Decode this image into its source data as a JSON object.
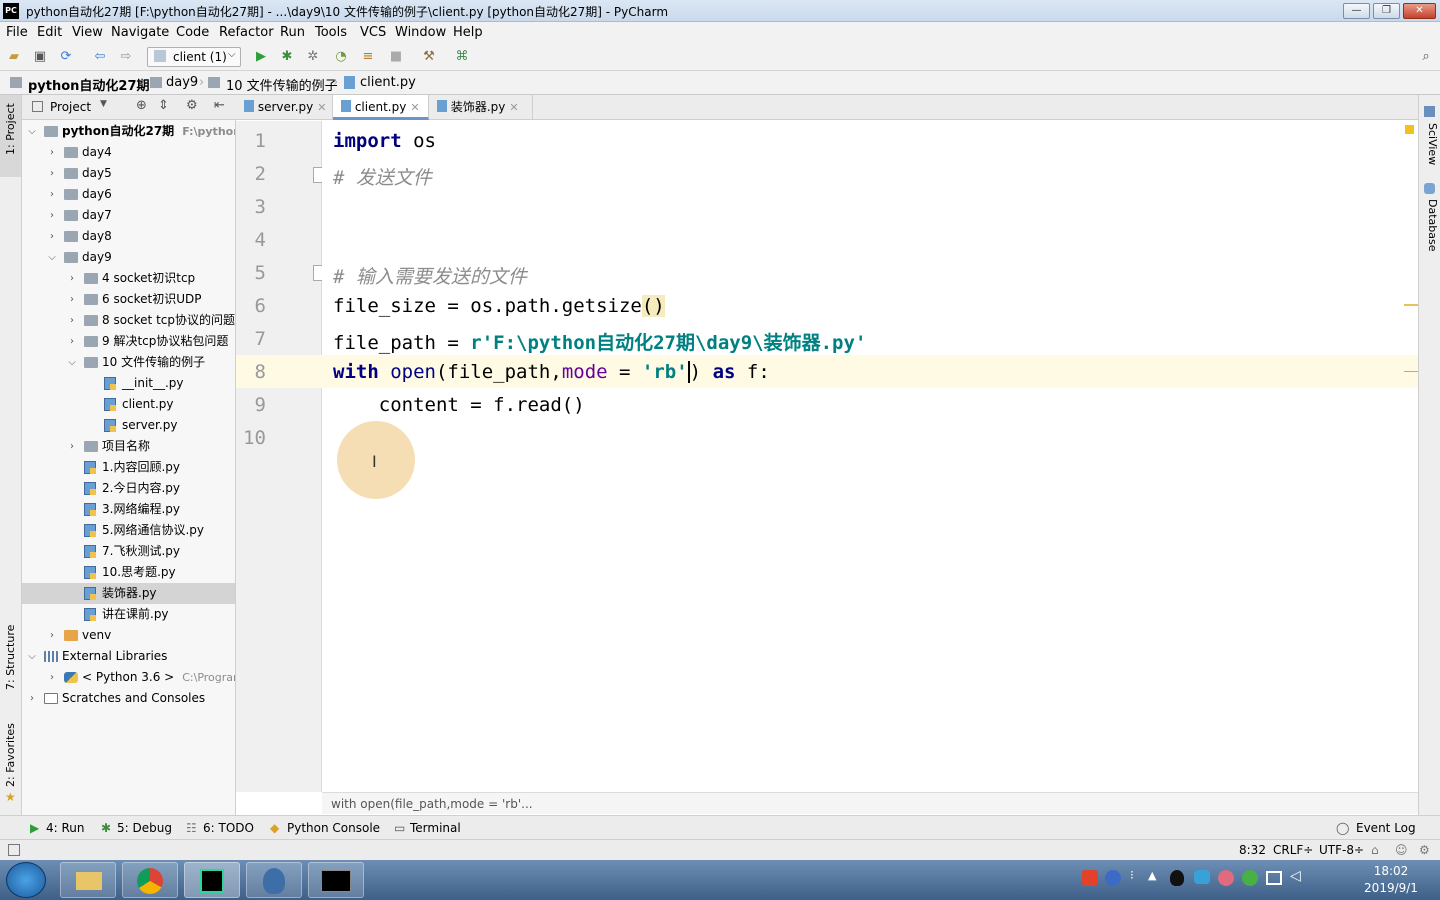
{
  "window": {
    "title": "python自动化27期 [F:\\python自动化27期] - ...\\day9\\10 文件传输的例子\\client.py [python自动化27期] - PyCharm",
    "app_icon": "PC",
    "min_label": "—",
    "max_label": "❐",
    "close_label": "✕"
  },
  "menu": [
    "File",
    "Edit",
    "View",
    "Navigate",
    "Code",
    "Refactor",
    "Run",
    "Tools",
    "VCS",
    "Window",
    "Help"
  ],
  "toolbar": {
    "run_config": "client (1)"
  },
  "breadcrumb": [
    "python自动化27期",
    "day9",
    "10 文件传输的例子",
    "client.py"
  ],
  "project_panel": {
    "title": "Project",
    "tree": [
      {
        "label": "python自动化27期",
        "hint": "F:\\python自",
        "kind": "folder",
        "depth": 0,
        "expanded": true,
        "bold": true
      },
      {
        "label": "day4",
        "kind": "folder",
        "depth": 1,
        "expanded": false
      },
      {
        "label": "day5",
        "kind": "folder",
        "depth": 1,
        "expanded": false
      },
      {
        "label": "day6",
        "kind": "folder",
        "depth": 1,
        "expanded": false
      },
      {
        "label": "day7",
        "kind": "folder",
        "depth": 1,
        "expanded": false
      },
      {
        "label": "day8",
        "kind": "folder",
        "depth": 1,
        "expanded": false
      },
      {
        "label": "day9",
        "kind": "folder",
        "depth": 1,
        "expanded": true
      },
      {
        "label": "4 socket初识tcp",
        "kind": "folder",
        "depth": 2,
        "expanded": false
      },
      {
        "label": "6 socket初识UDP",
        "kind": "folder",
        "depth": 2,
        "expanded": false
      },
      {
        "label": "8 socket tcp协议的问题",
        "kind": "folder",
        "depth": 2,
        "expanded": false
      },
      {
        "label": "9 解决tcp协议粘包问题",
        "kind": "folder",
        "depth": 2,
        "expanded": false
      },
      {
        "label": "10 文件传输的例子",
        "kind": "folder",
        "depth": 2,
        "expanded": true
      },
      {
        "label": "__init__.py",
        "kind": "py",
        "depth": 3
      },
      {
        "label": "client.py",
        "kind": "py",
        "depth": 3
      },
      {
        "label": "server.py",
        "kind": "py",
        "depth": 3
      },
      {
        "label": "项目名称",
        "kind": "folder",
        "depth": 2,
        "expanded": false
      },
      {
        "label": "1.内容回顾.py",
        "kind": "py",
        "depth": 2
      },
      {
        "label": "2.今日内容.py",
        "kind": "py",
        "depth": 2
      },
      {
        "label": "3.网络编程.py",
        "kind": "py",
        "depth": 2
      },
      {
        "label": "5.网络通信协议.py",
        "kind": "py",
        "depth": 2
      },
      {
        "label": "7.飞秋测试.py",
        "kind": "py",
        "depth": 2
      },
      {
        "label": "10.思考题.py",
        "kind": "py",
        "depth": 2
      },
      {
        "label": "装饰器.py",
        "kind": "py",
        "depth": 2,
        "selected": true
      },
      {
        "label": "讲在课前.py",
        "kind": "py",
        "depth": 2
      },
      {
        "label": "venv",
        "kind": "folder-orange",
        "depth": 1,
        "expanded": false
      },
      {
        "label": "External Libraries",
        "kind": "lib",
        "depth": 0,
        "expanded": true
      },
      {
        "label": "< Python 3.6 >",
        "hint": "C:\\Progran",
        "kind": "python",
        "depth": 1,
        "expanded": false
      },
      {
        "label": "Scratches and Consoles",
        "kind": "scratch",
        "depth": 0,
        "expanded": false
      }
    ]
  },
  "editor_tabs": [
    {
      "label": "server.py",
      "active": false
    },
    {
      "label": "client.py",
      "active": true
    },
    {
      "label": "装饰器.py",
      "active": false
    }
  ],
  "code_lines": [
    "1",
    "2",
    "3",
    "4",
    "5",
    "6",
    "7",
    "8",
    "9",
    "10"
  ],
  "code": {
    "l1_kw": "import",
    "l1_rest": " os",
    "l2": "# 发送文件",
    "l5": "# 输入需要发送的文件",
    "l6_a": "file_size = os.path.getsize",
    "l6_b": "()",
    "l7_a": "file_path = ",
    "l7_b": "r'F:\\python自动化27期\\day9\\装饰器.py'",
    "l8_kw": "with",
    "l8_bi": " open",
    "l8_a": "(file_path,",
    "l8_pm": "mode",
    "l8_b": " = ",
    "l8_st": "'rb'",
    "l8_c": ") ",
    "l8_as": "as",
    "l8_d": " f:",
    "l9": "    content = f.read()"
  },
  "editor_hint": "with open(file_path,mode = 'rb'...",
  "side_labels": {
    "project": "1: Project",
    "structure": "7: Structure",
    "favorites": "2: Favorites",
    "sciview": "SciView",
    "database": "Database"
  },
  "tool_tabs": [
    "4: Run",
    "5: Debug",
    "6: TODO",
    "Python Console",
    "Terminal"
  ],
  "event_log": "Event Log",
  "status": {
    "position": "8:32",
    "line_sep": "CRLF÷",
    "encoding": "UTF-8÷"
  },
  "clock": {
    "time": "18:02",
    "date": "2019/9/1"
  },
  "colors": {
    "keyword": "#000080",
    "comment": "#8c8c8c",
    "string": "#008080",
    "param": "#660099",
    "current_line": "#fffae3"
  }
}
